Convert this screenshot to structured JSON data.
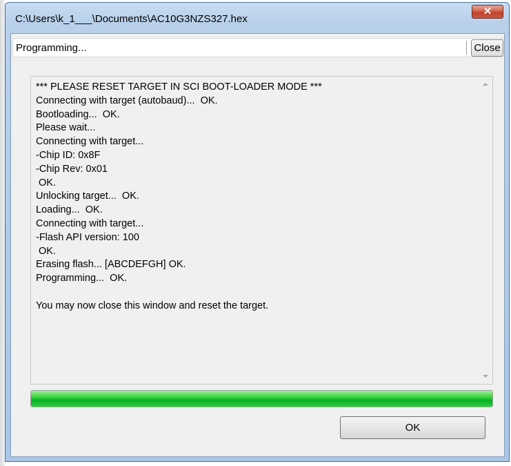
{
  "window": {
    "title": "C:\\Users\\k_1___\\Documents\\AC10G3NZS327.hex",
    "close_glyph": "✕"
  },
  "status": {
    "text": "Programming...",
    "close_label": "Close"
  },
  "log": {
    "lines": [
      "*** PLEASE RESET TARGET IN SCI BOOT-LOADER MODE ***",
      "Connecting with target (autobaud)...  OK.",
      "Bootloading...  OK.",
      "Please wait...",
      "Connecting with target...",
      "-Chip ID: 0x8F",
      "-Chip Rev: 0x01",
      " OK.",
      "Unlocking target...  OK.",
      "Loading...  OK.",
      "Connecting with target...",
      "-Flash API version: 100",
      " OK.",
      "Erasing flash... [ABCDEFGH] OK.",
      "Programming...  OK.",
      "",
      "You may now close this window and reset the target."
    ]
  },
  "progress": {
    "fraction": 1.0,
    "color": "#06b025"
  },
  "buttons": {
    "ok_label": "OK"
  }
}
